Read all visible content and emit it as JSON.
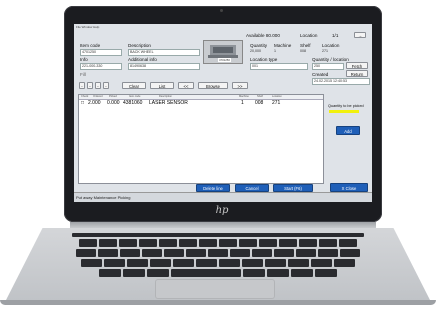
{
  "device": {
    "brand_logo": "hp"
  },
  "window": {
    "menu_text": "File  Window  Help"
  },
  "summary": {
    "available_label": "Available 80.000",
    "location_label": "Location",
    "page_label": "1/1",
    "nav_button": "→"
  },
  "item": {
    "item_code_label": "Item code",
    "item_code_value": "4701250",
    "description_label": "Description",
    "description_value": "BACK WHEEL",
    "info_label": "Info",
    "info_value": "221-000-330",
    "additional_label": "Additional info",
    "additional_value": "81490638",
    "fill_label": "Fill",
    "image_caption": "4701250"
  },
  "stock": {
    "quantity_label": "Quantity",
    "quantity_value": "20,000",
    "machine_label": "Machine",
    "machine_value": "1",
    "shelf_label": "Shelf",
    "shelf_value": "008",
    "location_label": "Location",
    "location_value": "271",
    "location_type_label": "Location type",
    "location_type_value": "001",
    "qty_location_label": "Quantity / location",
    "qty_location_value": "250",
    "fetch_button": "Fetch",
    "created_label": "Created",
    "created_value": "24.02.2015 12:40:53",
    "return_button": "Return"
  },
  "toolbar": {
    "minus_buttons": [
      "-",
      "-",
      "-",
      "-"
    ],
    "clear_button": "Clear",
    "list_button": "List",
    "prev_button": "<<",
    "browse_button": "Browse",
    "next_button": ">>"
  },
  "table": {
    "columns": [
      "Check",
      "Ordered",
      "Picked",
      "Item code",
      "Description",
      "Machine",
      "Shelf",
      "Location"
    ],
    "rows": [
      [
        "□",
        "2.000",
        "0.000",
        "4381060",
        "LASER SENSOR",
        "1",
        "008",
        "271"
      ]
    ]
  },
  "side": {
    "qty_to_pick_label": "Quantity to be picked",
    "add_button": "Add",
    "close_button": "X Close"
  },
  "actions": {
    "delete_button": "Delete line",
    "cancel_button": "Cancel",
    "start_button": "Start (F6)"
  },
  "status": {
    "text": "Put away Maintenance Picking"
  },
  "colors": {
    "accent": "#1f5fb8",
    "highlight": "#f1f10d"
  }
}
